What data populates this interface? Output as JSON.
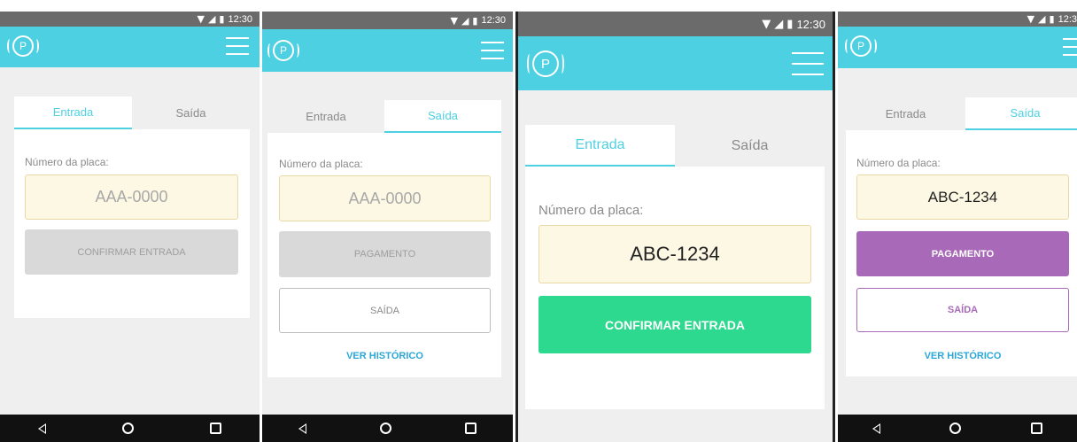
{
  "status": {
    "time": "12:30",
    "time_cut": "12:3"
  },
  "app": {
    "logo_letter": "P"
  },
  "tabs": {
    "entrada": "Entrada",
    "saida": "Saída"
  },
  "form": {
    "plate_label": "Número da placa:",
    "plate_placeholder": "AAA-0000",
    "plate_value": "ABC-1234"
  },
  "buttons": {
    "confirmar_entrada": "CONFIRMAR ENTRADA",
    "pagamento": "PAGAMENTO",
    "saida": "SAÍDA",
    "ver_historico": "VER HISTÓRICO"
  },
  "colors": {
    "appbar": "#4ed0e3",
    "green": "#2cd98f",
    "purple": "#a86ab8",
    "plate_bg": "#fdf8e4"
  }
}
